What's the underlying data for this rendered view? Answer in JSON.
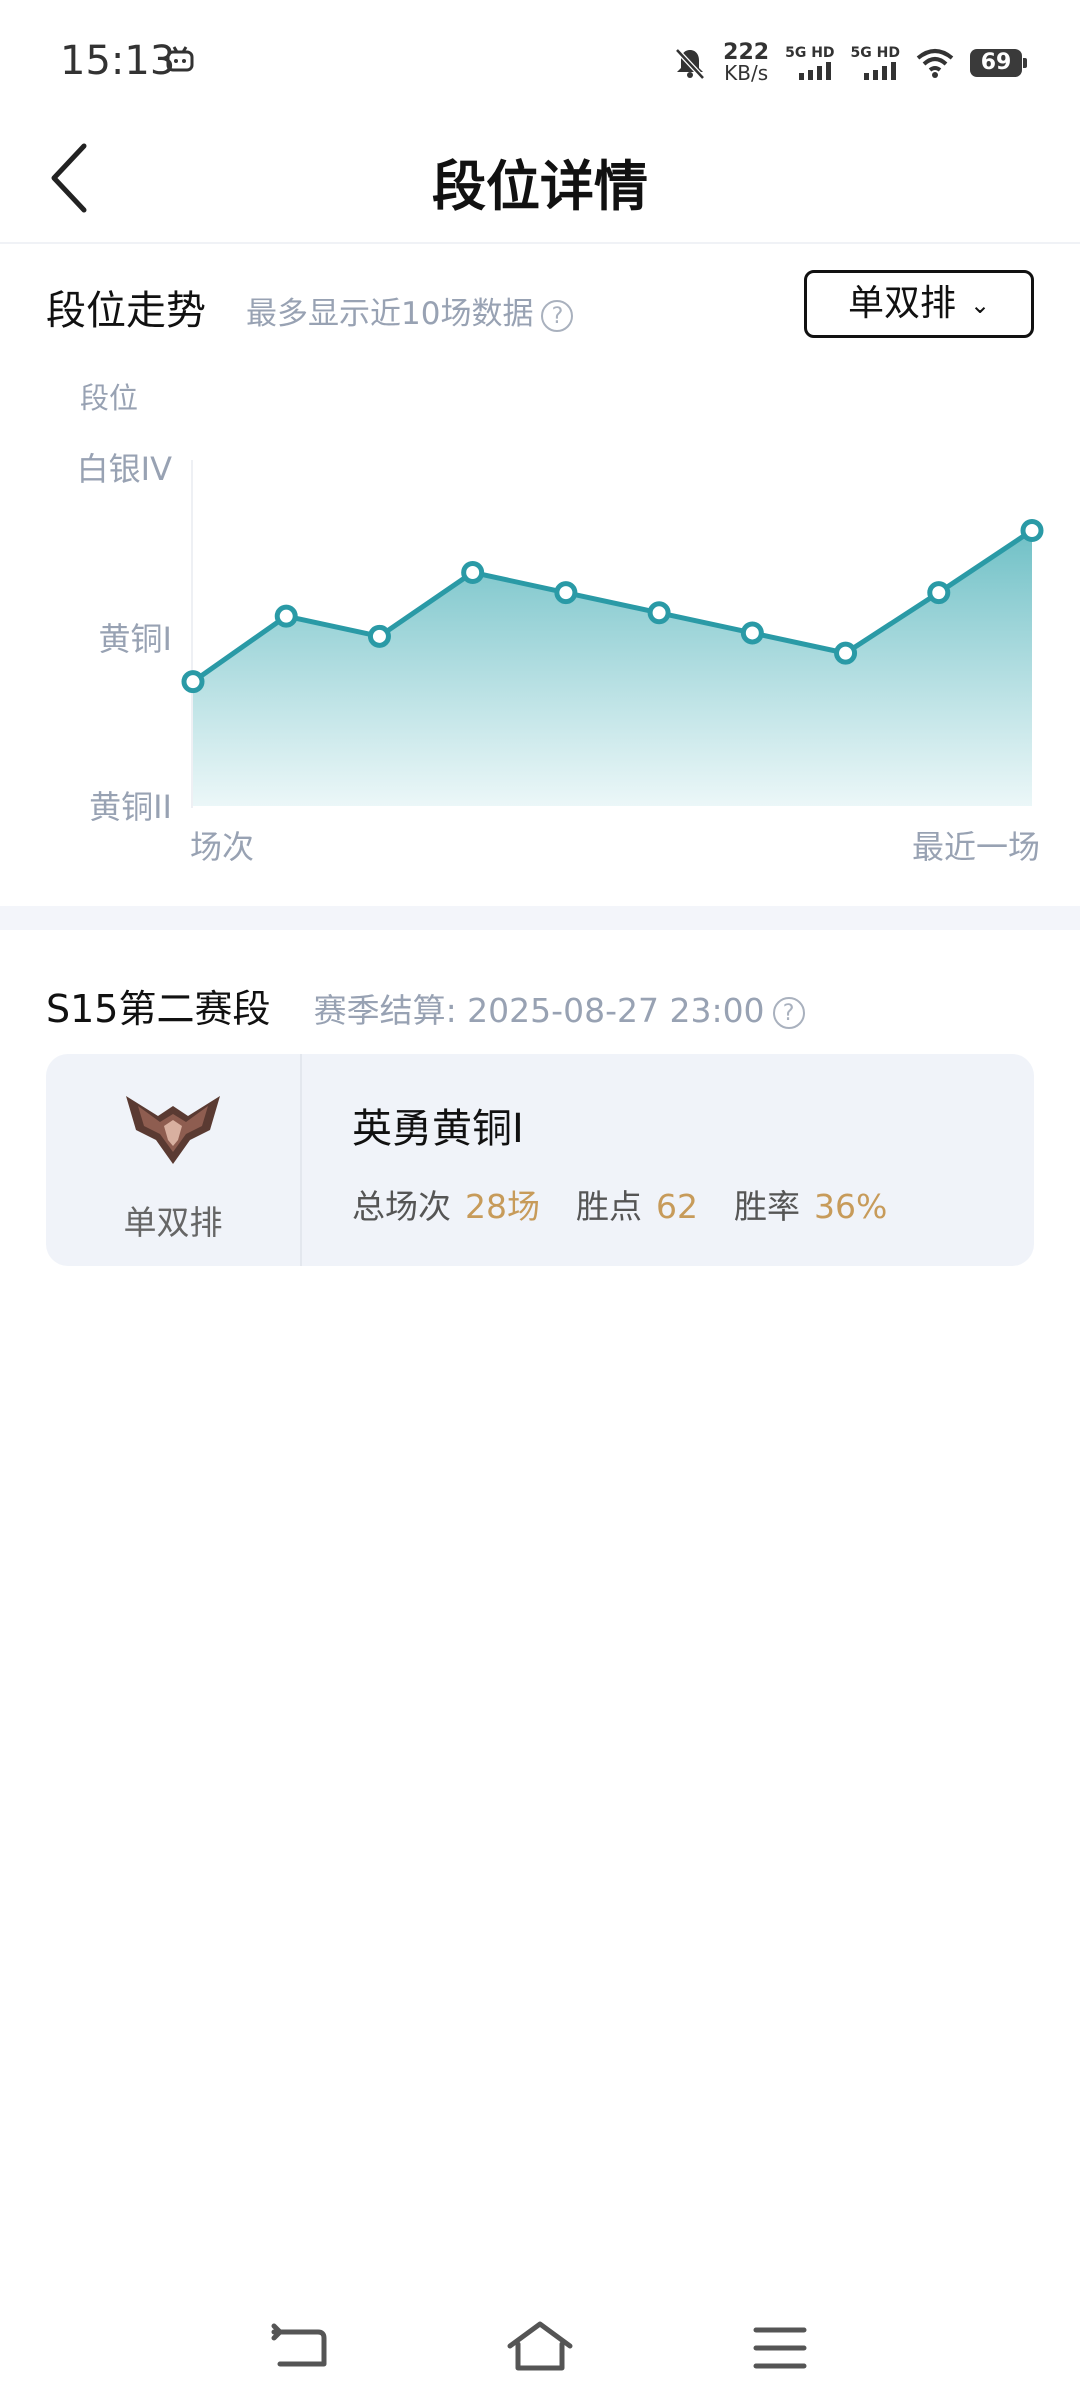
{
  "status_bar": {
    "time": "15:13",
    "net_speed_value": "222",
    "net_speed_unit": "KB/s",
    "sim1_label": "5G HD",
    "sim2_label": "5G HD",
    "battery": "69"
  },
  "header": {
    "title": "段位详情"
  },
  "trend": {
    "title": "段位走势",
    "subtitle": "最多显示近10场数据",
    "help_glyph": "?",
    "queue_select": "单双排"
  },
  "chart_data": {
    "type": "area",
    "title": "",
    "ylabel": "段位",
    "y_tick_labels": [
      "白银IV",
      "黄铜I",
      "黄铜II"
    ],
    "x_start_label": "场次",
    "x_end_label": "最近一场",
    "ylim_note": "y axis is rank tiers: 黄铜II (bottom), 黄铜I, 白银IV (top)",
    "values": [
      0.74,
      1.13,
      1.01,
      1.39,
      1.27,
      1.15,
      1.03,
      0.91,
      1.27,
      1.64
    ],
    "ylim": [
      0,
      2
    ],
    "grid": false,
    "legend": "none",
    "line_color": "#2a9aa6",
    "fill_top_color": "#6fc0c6"
  },
  "season": {
    "title": "S15第二赛段",
    "end_label": "赛季结算: 2025-08-27 23:00",
    "help_glyph": "?"
  },
  "rank_card": {
    "queue": "单双排",
    "rank_name": "英勇黄铜I",
    "games_label": "总场次",
    "games_value": "28场",
    "points_label": "胜点",
    "points_value": "62",
    "winrate_label": "胜率",
    "winrate_value": "36%"
  }
}
